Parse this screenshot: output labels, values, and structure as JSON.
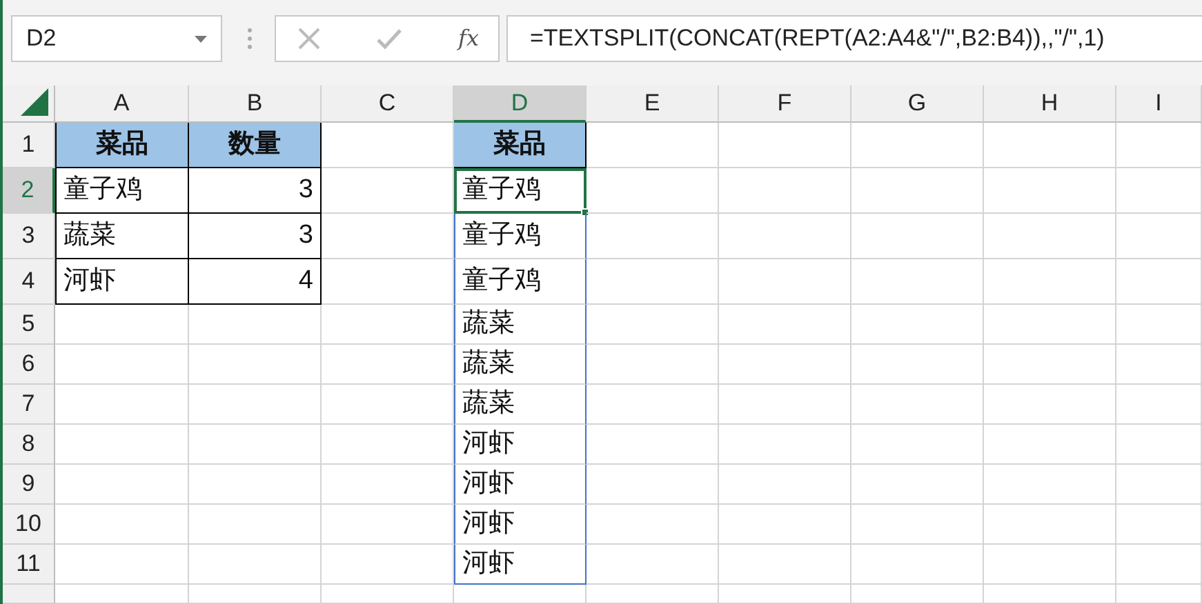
{
  "name_box": {
    "value": "D2"
  },
  "formula_bar": {
    "function_label": "fx",
    "value": "=TEXTSPLIT(CONCAT(REPT(A2:A4&\"/\",B2:B4)),,\"/\",1)"
  },
  "sheet": {
    "columns": [
      {
        "label": "A",
        "selected": false
      },
      {
        "label": "B",
        "selected": false
      },
      {
        "label": "C",
        "selected": false
      },
      {
        "label": "D",
        "selected": true
      },
      {
        "label": "E",
        "selected": false
      },
      {
        "label": "F",
        "selected": false
      },
      {
        "label": "G",
        "selected": false
      },
      {
        "label": "H",
        "selected": false
      },
      {
        "label": "I",
        "selected": false
      }
    ],
    "rows": [
      {
        "label": "1",
        "selected": false,
        "cells": [
          {
            "kind": "header",
            "text": "菜品",
            "selected": false
          },
          {
            "kind": "header",
            "text": "数量",
            "selected": false
          },
          {
            "kind": "empty",
            "selected": false
          },
          {
            "kind": "header",
            "text": "菜品",
            "selected": false
          }
        ]
      },
      {
        "label": "2",
        "selected": true,
        "cells": [
          {
            "kind": "text",
            "text": "童子鸡",
            "selected": false
          },
          {
            "kind": "number",
            "text": "3",
            "selected": false
          },
          {
            "kind": "empty",
            "selected": false
          },
          {
            "kind": "spill",
            "text": "童子鸡",
            "selected": true
          }
        ]
      },
      {
        "label": "3",
        "selected": false,
        "cells": [
          {
            "kind": "text",
            "text": "蔬菜",
            "selected": false
          },
          {
            "kind": "number",
            "text": "3",
            "selected": false
          },
          {
            "kind": "empty",
            "selected": false
          },
          {
            "kind": "spill",
            "text": "童子鸡",
            "selected": false
          }
        ]
      },
      {
        "label": "4",
        "selected": false,
        "cells": [
          {
            "kind": "text",
            "text": "河虾",
            "selected": false
          },
          {
            "kind": "number",
            "text": "4",
            "selected": false
          },
          {
            "kind": "empty",
            "selected": false
          },
          {
            "kind": "spill",
            "text": "童子鸡",
            "selected": false
          }
        ]
      },
      {
        "label": "5",
        "selected": false,
        "cells": [
          {
            "kind": "empty",
            "selected": false
          },
          {
            "kind": "empty",
            "selected": false
          },
          {
            "kind": "empty",
            "selected": false
          },
          {
            "kind": "spill",
            "text": "蔬菜",
            "selected": false
          }
        ]
      },
      {
        "label": "6",
        "selected": false,
        "cells": [
          {
            "kind": "empty",
            "selected": false
          },
          {
            "kind": "empty",
            "selected": false
          },
          {
            "kind": "empty",
            "selected": false
          },
          {
            "kind": "spill",
            "text": "蔬菜",
            "selected": false
          }
        ]
      },
      {
        "label": "7",
        "selected": false,
        "cells": [
          {
            "kind": "empty",
            "selected": false
          },
          {
            "kind": "empty",
            "selected": false
          },
          {
            "kind": "empty",
            "selected": false
          },
          {
            "kind": "spill",
            "text": "蔬菜",
            "selected": false
          }
        ]
      },
      {
        "label": "8",
        "selected": false,
        "cells": [
          {
            "kind": "empty",
            "selected": false
          },
          {
            "kind": "empty",
            "selected": false
          },
          {
            "kind": "empty",
            "selected": false
          },
          {
            "kind": "spill",
            "text": "河虾",
            "selected": false
          }
        ]
      },
      {
        "label": "9",
        "selected": false,
        "cells": [
          {
            "kind": "empty",
            "selected": false
          },
          {
            "kind": "empty",
            "selected": false
          },
          {
            "kind": "empty",
            "selected": false
          },
          {
            "kind": "spill",
            "text": "河虾",
            "selected": false
          }
        ]
      },
      {
        "label": "10",
        "selected": false,
        "cells": [
          {
            "kind": "empty",
            "selected": false
          },
          {
            "kind": "empty",
            "selected": false
          },
          {
            "kind": "empty",
            "selected": false
          },
          {
            "kind": "spill",
            "text": "河虾",
            "selected": false
          }
        ]
      },
      {
        "label": "11",
        "selected": false,
        "cells": [
          {
            "kind": "empty",
            "selected": false
          },
          {
            "kind": "empty",
            "selected": false
          },
          {
            "kind": "empty",
            "selected": false
          },
          {
            "kind": "spill",
            "text": "河虾",
            "selected": false
          }
        ]
      },
      {
        "selected": false,
        "cells": []
      }
    ]
  }
}
